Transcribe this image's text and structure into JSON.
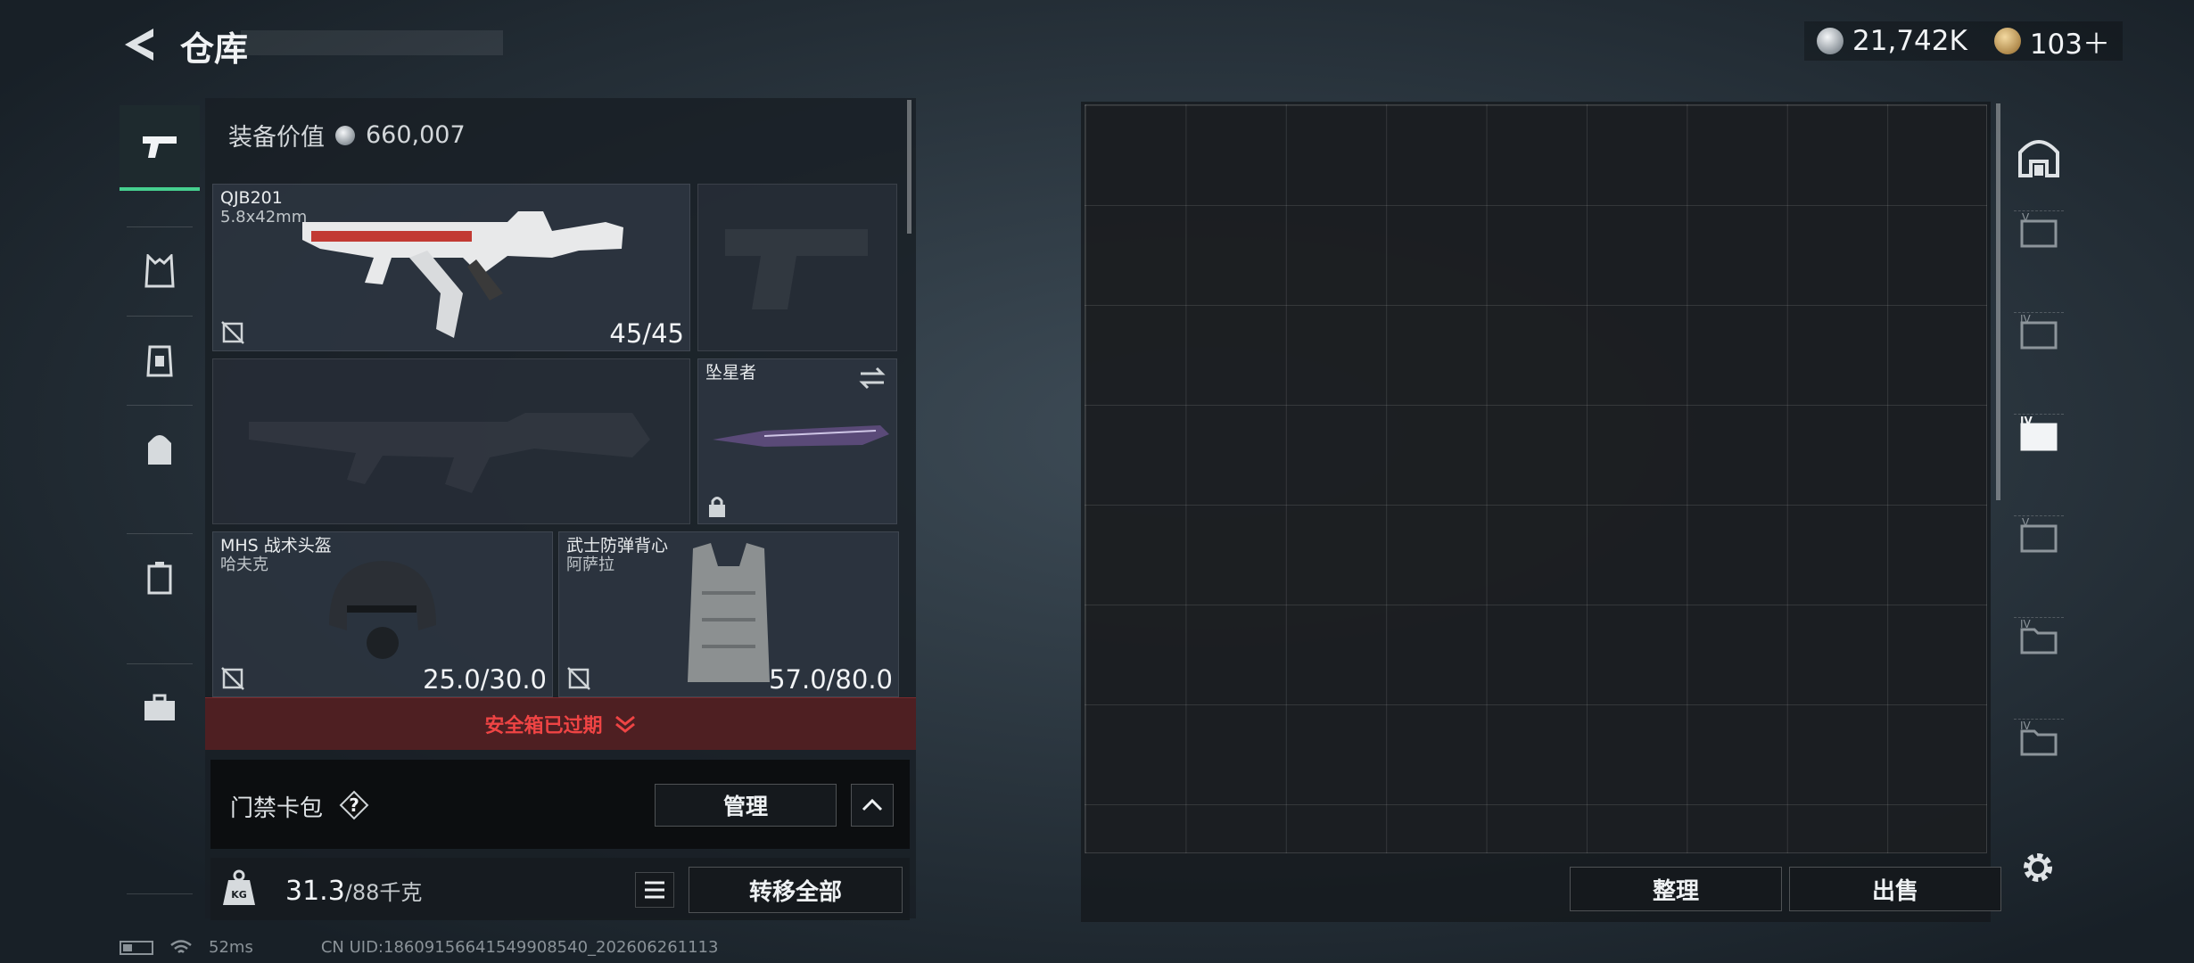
{
  "header": {
    "title": "仓库",
    "currency_silver": "21,742K",
    "currency_gold": "103＋"
  },
  "rail": {
    "items": [
      "pistol-icon",
      "vest-rig-icon",
      "armor-icon",
      "backpack-icon",
      "case-icon",
      "toolbox-icon"
    ]
  },
  "loadout": {
    "equip_value_label": "装备价值",
    "equip_value": "660,007",
    "primary": {
      "name": "QJB201",
      "ammo": "5.8x42mm",
      "value": "45/45"
    },
    "melee": {
      "name": "坠星者"
    },
    "helmet": {
      "name": "MHS 战术头盔",
      "sub": "哈夫克",
      "value": "25.0/30.0"
    },
    "vest": {
      "name": "武士防弹背心",
      "sub": "阿萨拉",
      "value": "57.0/80.0"
    }
  },
  "alert": {
    "text": "安全箱已过期"
  },
  "keycard": {
    "label": "门禁卡包",
    "help": "?",
    "manage": "管理"
  },
  "weight": {
    "current": "31.3",
    "max": "/88千克"
  },
  "actions": {
    "transfer_all": "转移全部",
    "sort": "整理",
    "sell": "出售"
  },
  "vault_tabs": [
    "storage-main-icon",
    "vault-v-icon",
    "vault-iv-icon",
    "vault-iv-active-icon",
    "vault-v2-icon",
    "vault-iv-folder-icon",
    "vault-iv-folder2-icon"
  ],
  "status": {
    "latency": "52ms",
    "uid": "CN UID:18609156641549908540_202606261113"
  },
  "colors": {
    "accent_green": "#46d08f",
    "alert_red": "#ef4444",
    "alert_bg": "#4e1f22"
  }
}
